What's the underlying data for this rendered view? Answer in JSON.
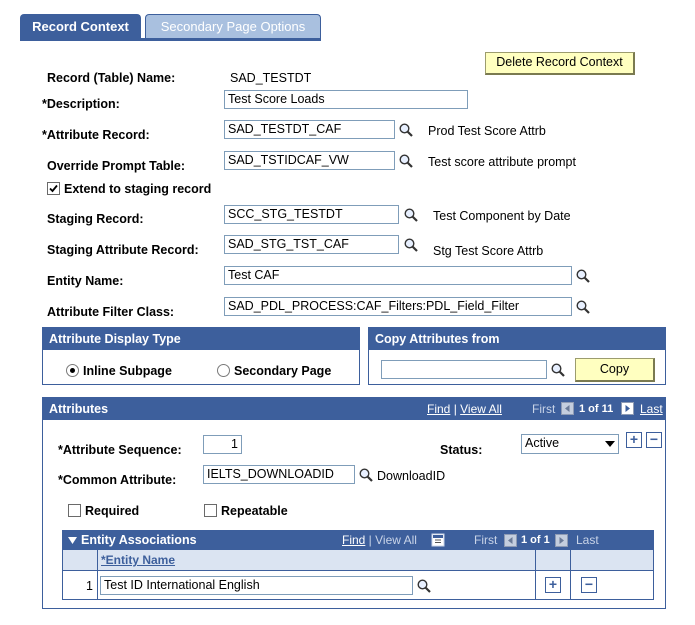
{
  "tabs": {
    "record_context": "Record Context",
    "secondary_page_options": "Secondary Page Options"
  },
  "delete_button": "Delete Record Context",
  "fields": {
    "record_name_label": "Record (Table) Name:",
    "record_name_value": "SAD_TESTDT",
    "description_label": "*Description:",
    "description_value": "Test Score Loads",
    "attribute_record_label": "*Attribute Record:",
    "attribute_record_value": "SAD_TESTDT_CAF",
    "attribute_record_desc": "Prod Test Score Attrb",
    "override_prompt_label": "Override Prompt Table:",
    "override_prompt_value": "SAD_TSTIDCAF_VW",
    "override_prompt_desc": "Test score attribute prompt",
    "extend_label": "Extend to staging record",
    "staging_record_label": "Staging Record:",
    "staging_record_value": "SCC_STG_TESTDT",
    "staging_record_desc": "Test Component by Date",
    "staging_attr_label": "Staging Attribute Record:",
    "staging_attr_value": "SAD_STG_TST_CAF",
    "staging_attr_desc": "Stg Test Score Attrb",
    "entity_name_label": "Entity Name:",
    "entity_name_value": "Test CAF",
    "filter_class_label": "Attribute Filter Class:",
    "filter_class_value": "SAD_PDL_PROCESS:CAF_Filters:PDL_Field_Filter"
  },
  "display_type": {
    "title": "Attribute Display Type",
    "inline": "Inline Subpage",
    "secondary": "Secondary Page",
    "selected": "inline"
  },
  "copy_attrs": {
    "title": "Copy Attributes from",
    "input_value": "",
    "button": "Copy"
  },
  "attributes": {
    "title": "Attributes",
    "find": "Find",
    "view_all": "View All",
    "first": "First",
    "counter": "1 of 11",
    "last": "Last",
    "seq_label": "*Attribute Sequence:",
    "seq_value": "1",
    "status_label": "Status:",
    "status_value": "Active",
    "common_label": "*Common Attribute:",
    "common_value": "IELTS_DOWNLOADID",
    "common_desc": "DownloadID",
    "required_label": "Required",
    "repeatable_label": "Repeatable",
    "add": "+",
    "remove": "−"
  },
  "entity_assoc": {
    "title": "Entity Associations",
    "find": "Find",
    "view_all": "View All",
    "first": "First",
    "counter": "1 of 1",
    "last": "Last",
    "column": "*Entity Name",
    "rows": [
      {
        "num": "1",
        "entity": "Test ID International English"
      }
    ],
    "add": "+",
    "remove": "−"
  },
  "colors": {
    "header": "#3d5f9c",
    "button_bg": "#ffffc0",
    "tab_inactive": "#a9c0df"
  }
}
